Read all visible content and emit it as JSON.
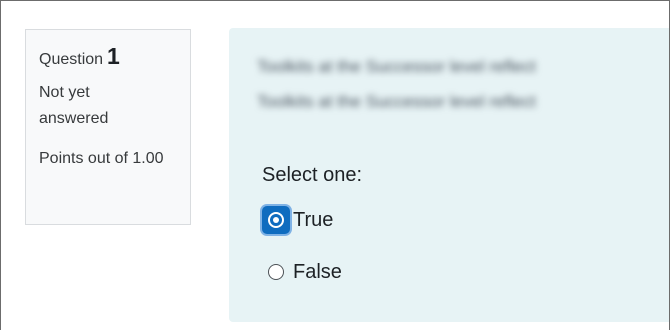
{
  "question_info": {
    "label": "Question",
    "number": "1",
    "state": "Not yet answered",
    "grade": "Points out of 1.00"
  },
  "question": {
    "blurred_text_line_1": "Toolkits at the Successor level reflect",
    "blurred_text_line_2": "Toolkits at the Successor level reflect",
    "prompt": "Select one:",
    "options": [
      {
        "label": "True",
        "selected": true
      },
      {
        "label": "False",
        "selected": false
      }
    ]
  },
  "colors": {
    "accent": "#0f6cbf",
    "content_background": "#e7f3f5",
    "info_background": "#f8f9fa"
  },
  "icons": {
    "selected_radio": "radio-checked-icon",
    "unselected_radio": "radio-unchecked-icon"
  }
}
